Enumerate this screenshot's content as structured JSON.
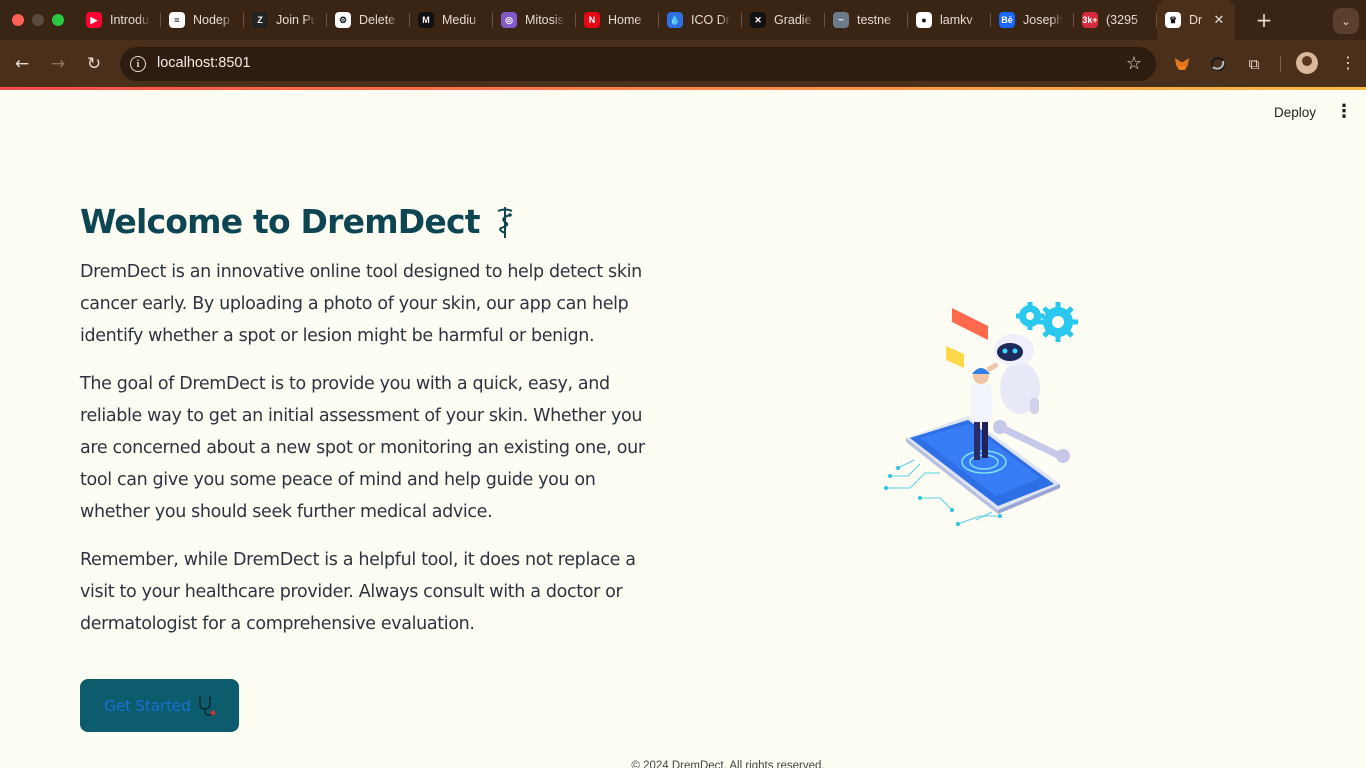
{
  "browser": {
    "tabs": [
      {
        "label": "Introdu",
        "icon": "youtube-icon",
        "color": "#ff0033"
      },
      {
        "label": "Nodep",
        "icon": "chart-icon",
        "color": "#ffffff"
      },
      {
        "label": "Join Pu",
        "icon": "zoom-icon",
        "color": "#222222"
      },
      {
        "label": "Delete",
        "icon": "openai-icon",
        "color": "#ffffff"
      },
      {
        "label": "Mediu",
        "icon": "medium-icon",
        "color": "#111111"
      },
      {
        "label": "Mitosis",
        "icon": "mitosis-icon",
        "color": "#7f5ac8"
      },
      {
        "label": "Home",
        "icon": "netflix-icon",
        "color": "#e50914"
      },
      {
        "label": "ICO Dr",
        "icon": "drop-icon",
        "color": "#2f6fe0"
      },
      {
        "label": "Gradie",
        "icon": "gradient-icon",
        "color": "#111111"
      },
      {
        "label": "testne",
        "icon": "wave-icon",
        "color": "#6b7b8c"
      },
      {
        "label": "lamkv",
        "icon": "github-icon",
        "color": "#ffffff"
      },
      {
        "label": "Joseph",
        "icon": "behance-icon",
        "color": "#1769ff"
      },
      {
        "label": "(3295",
        "icon": "badge-icon",
        "color": "#d62b3a"
      },
      {
        "label": "Dr",
        "icon": "crown-icon",
        "color": "#ffffff"
      }
    ],
    "fav_text": [
      "▶",
      "≈",
      "Z",
      "⚙",
      "M",
      "◎",
      "N",
      "💧",
      "✕",
      "~",
      "●",
      "Bē",
      "3k+",
      "♛"
    ],
    "url": "localhost:8501"
  },
  "app": {
    "deploy_label": "Deploy",
    "title": "Welcome to DremDect",
    "paragraphs": [
      "DremDect is an innovative online tool designed to help detect skin cancer early. By uploading a photo of your skin, our app can help identify whether a spot or lesion might be harmful or benign.",
      "The goal of DremDect is to provide you with a quick, easy, and reliable way to get an initial assessment of your skin. Whether you are concerned about a new spot or monitoring an existing one, our tool can give you some peace of mind and help guide you on whether you should seek further medical advice.",
      "Remember, while DremDect is a helpful tool, it does not replace a visit to your healthcare provider. Always consult with a doctor or dermatologist for a comprehensive evaluation."
    ],
    "cta_label": "Get Started",
    "footer": "© 2024 DremDect. All rights reserved."
  },
  "colors": {
    "page_bg": "#fdfdf4",
    "title": "#0e4552",
    "button_bg": "#0c5c6e",
    "button_text": "#1b6fd1",
    "chrome_bg": "#3a2414"
  }
}
